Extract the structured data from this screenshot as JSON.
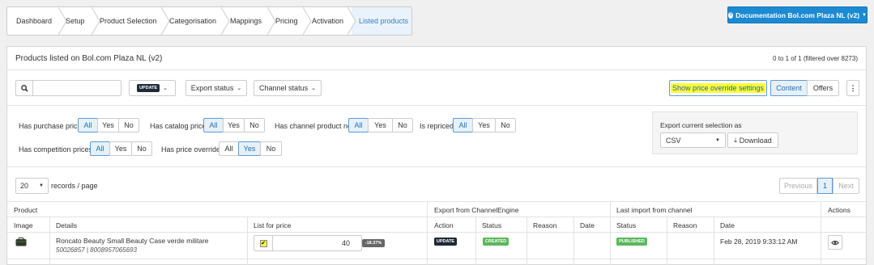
{
  "breadcrumb": [
    "Dashboard",
    "Setup",
    "Product Selection",
    "Categorisation",
    "Mappings",
    "Pricing",
    "Activation",
    "Listed products"
  ],
  "doc_button": "Documentation Bol.com Plaza NL (v2)",
  "panel_title": "Products listed on Bol.com Plaza NL (v2)",
  "count_text": "0 to 1 of 1 (filtered over 8273)",
  "toolbar": {
    "search_value": "",
    "update_label": "UPDATE",
    "export_status": "Export status",
    "channel_status": "Channel status",
    "show_override": "Show price override settings",
    "content": "Content",
    "offers": "Offers"
  },
  "filters": {
    "purchase": "Has purchase price",
    "catalog": "Has catalog price",
    "channel_no": "Has channel product no",
    "repriced": "Is repriced",
    "competition": "Has competition prices",
    "override": "Has price override",
    "all": "All",
    "yes": "Yes",
    "no": "No"
  },
  "export": {
    "title": "Export current selection as",
    "format": "CSV",
    "download": "Download"
  },
  "pagination": {
    "per_page": "20",
    "records_label": "records / page",
    "previous": "Previous",
    "page": "1",
    "next": "Next"
  },
  "table": {
    "group_product": "Product",
    "group_export": "Export from ChannelEngine",
    "group_import": "Last import from channel",
    "group_actions": "Actions",
    "col_image": "Image",
    "col_details": "Details",
    "col_list_price": "List for price",
    "col_action": "Action",
    "col_status": "Status",
    "col_reason": "Reason",
    "col_date": "Date",
    "col_status2": "Status",
    "col_reason2": "Reason",
    "col_date2": "Date",
    "row": {
      "name": "Roncato Beauty Small Beauty Case verde militare",
      "ids": "50026857 | 8008957065693",
      "price": "40",
      "pct": "-18.37%",
      "action": "UPDATE",
      "export_status": "CREATED",
      "import_status": "PUBLISHED",
      "date": "Feb 28, 2019 9:33:12 AM"
    }
  },
  "colors": {
    "primary": "#1b8ad3",
    "highlight": "#ffff3a",
    "dark_badge": "#1e2a38",
    "green_badge": "#5cb85c"
  }
}
